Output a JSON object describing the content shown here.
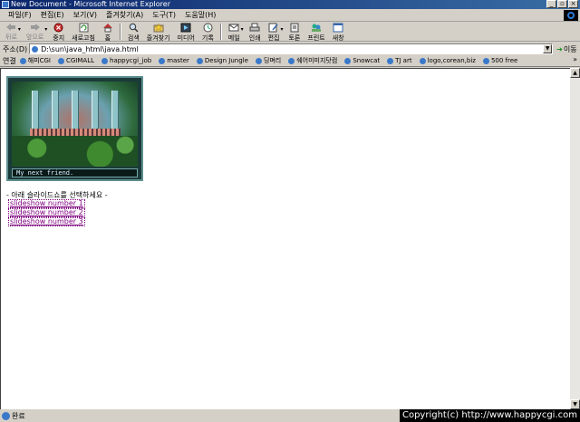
{
  "window": {
    "title": "New Document - Microsoft Internet Explorer",
    "controls": {
      "minimize": "_",
      "maximize": "▫",
      "close": "×"
    }
  },
  "menubar": {
    "items": [
      {
        "label": "파일(F)"
      },
      {
        "label": "편집(E)"
      },
      {
        "label": "보기(V)"
      },
      {
        "label": "즐겨찾기(A)"
      },
      {
        "label": "도구(T)"
      },
      {
        "label": "도움말(H)"
      }
    ]
  },
  "toolbar": {
    "back": "뒤로",
    "forward": "앞으로",
    "stop": "중지",
    "refresh": "새로고침",
    "home": "홈",
    "search": "검색",
    "favorites": "즐겨찾기",
    "media": "미디어",
    "history": "기록",
    "mail": "메일",
    "print": "인쇄",
    "edit": "편집",
    "discuss": "토론",
    "print2": "프린트",
    "messenger": "새창"
  },
  "address": {
    "label": "주소(D)",
    "value": "D:\\sun\\java_html\\java.html",
    "go": "이동"
  },
  "links": {
    "label": "연결",
    "items": [
      {
        "label": "해피CGI"
      },
      {
        "label": "CGIMALL"
      },
      {
        "label": "happycgi_job"
      },
      {
        "label": "master"
      },
      {
        "label": "Design Jungle"
      },
      {
        "label": "딩며리"
      },
      {
        "label": "쉐어미미지닷컴"
      },
      {
        "label": "Snowcat"
      },
      {
        "label": "TJ art"
      },
      {
        "label": "logo,corean,biz"
      },
      {
        "label": "500 free"
      }
    ],
    "more": "»"
  },
  "page": {
    "banner_caption": "My next friend.",
    "prompt": "- 아래 슬라이드쇼를 선택하세요 -",
    "slideshow_links": [
      {
        "label": "slideshow number 1"
      },
      {
        "label": "slideshow number 2"
      },
      {
        "label": "slideshow number 3"
      }
    ]
  },
  "status": {
    "text": "완료",
    "copyright": "Copyright(c) http://www.happycgi.com"
  }
}
